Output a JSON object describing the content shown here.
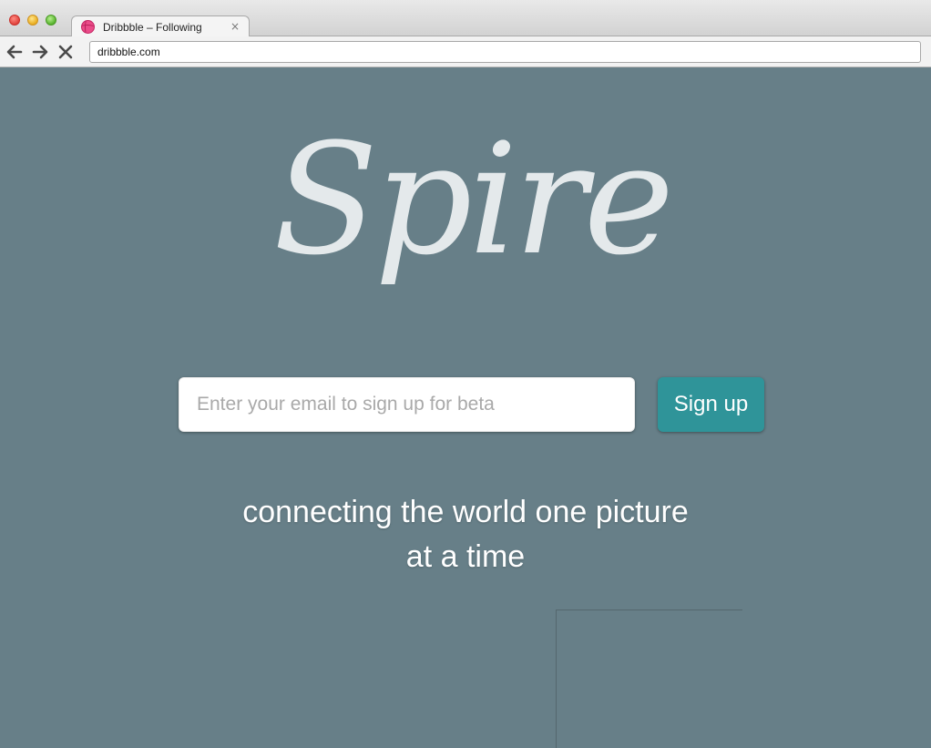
{
  "browser": {
    "tab": {
      "title": "Dribbble – Following",
      "close_glyph": "×",
      "favicon_icon": "dribbble-icon"
    },
    "toolbar": {
      "back_icon": "arrow-left-icon",
      "forward_icon": "arrow-right-icon",
      "stop_icon": "close-icon",
      "url": "dribbble.com"
    }
  },
  "page": {
    "logo_text": "Spire",
    "signup": {
      "email_placeholder": "Enter your email to sign up for beta",
      "email_value": "",
      "button_label": "Sign up"
    },
    "tagline": {
      "line1": "connecting the world one picture",
      "line2": "at a time"
    }
  },
  "colors": {
    "background": "#677f88",
    "logo": "#e4e9eb",
    "button": "#2f9499",
    "button_text": "#ffffff",
    "tagline": "#ffffff"
  }
}
